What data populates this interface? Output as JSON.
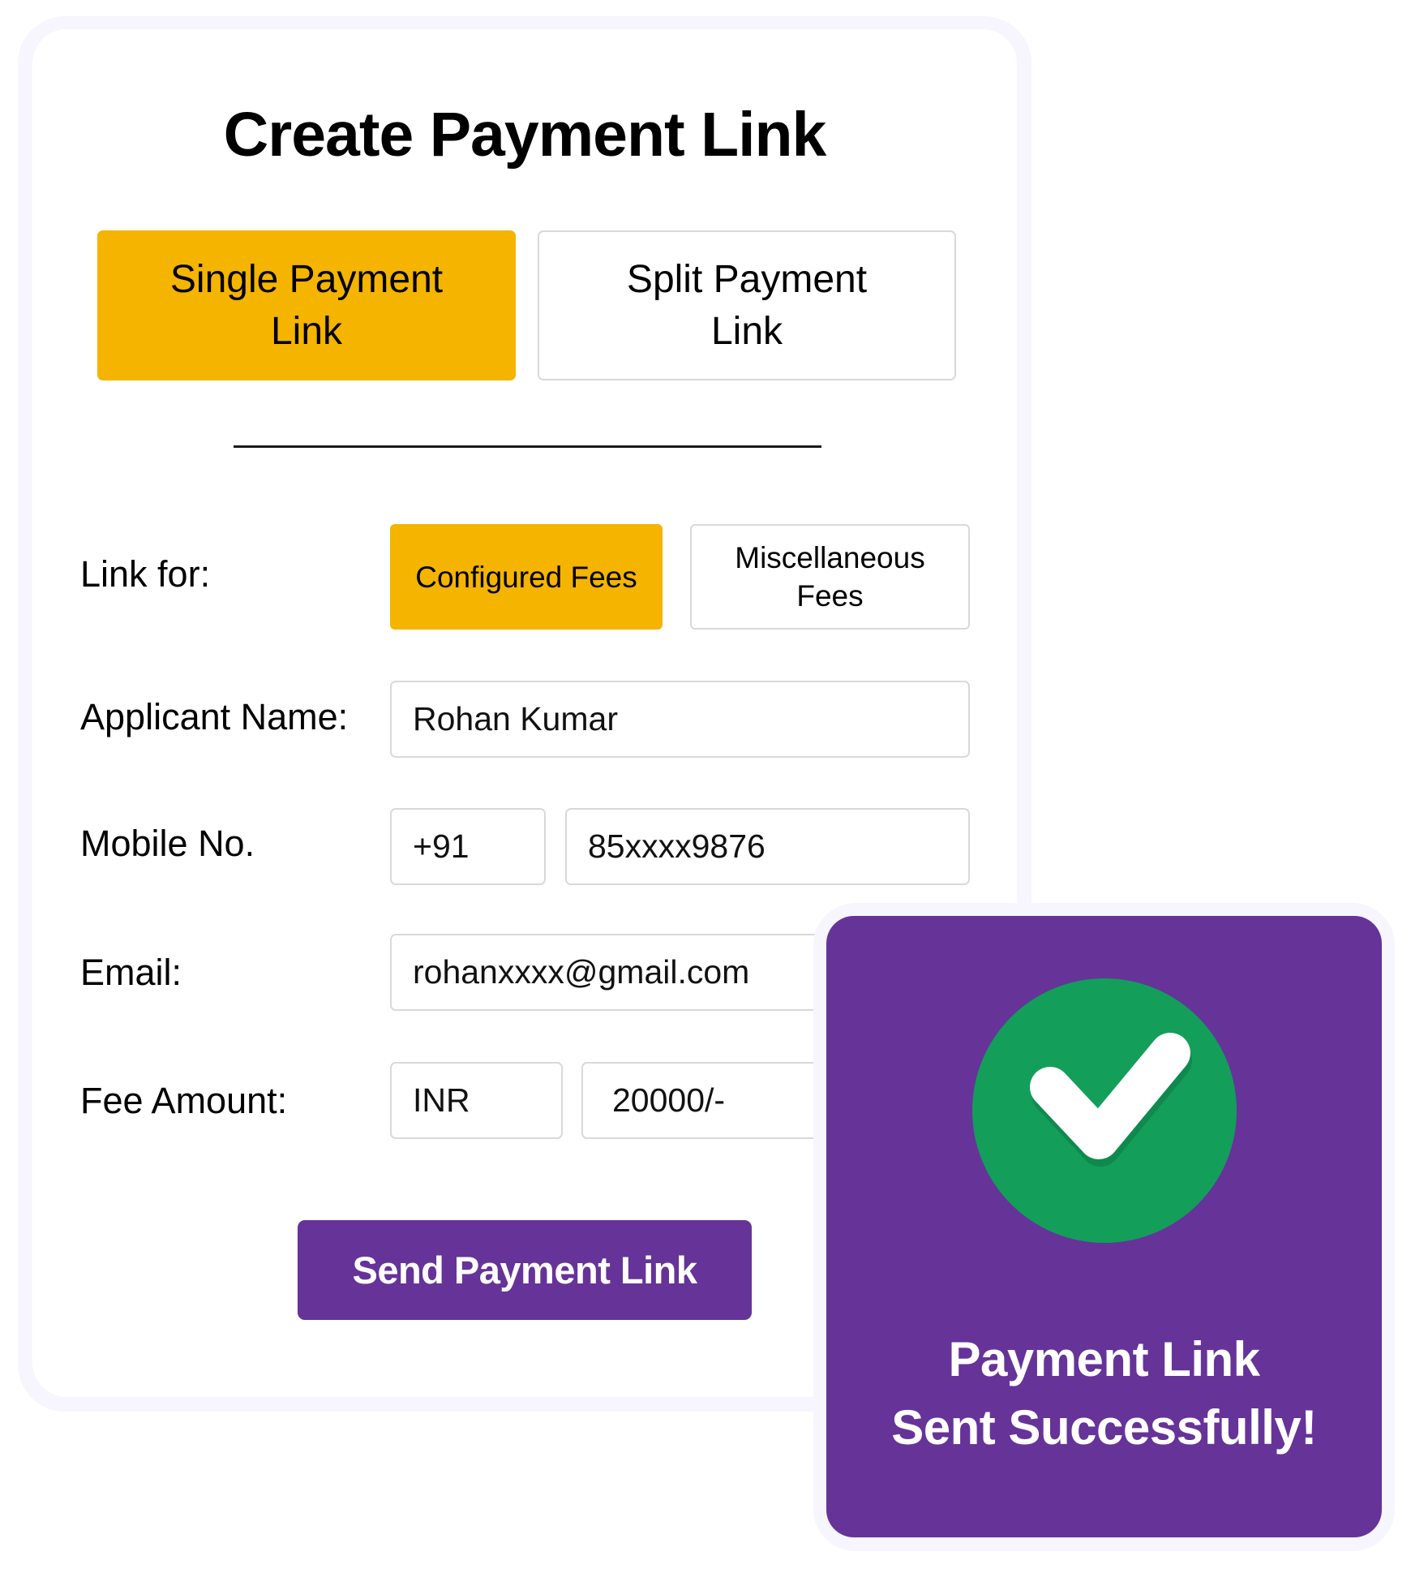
{
  "form": {
    "title": "Create Payment Link",
    "link_types": [
      {
        "label": "Single Payment Link",
        "selected": true
      },
      {
        "label": "Split Payment Link",
        "selected": false
      }
    ],
    "link_for": {
      "label": "Link for:",
      "options": [
        {
          "label": "Configured Fees",
          "selected": true
        },
        {
          "label": "Miscellaneous Fees",
          "selected": false
        }
      ]
    },
    "applicant_name": {
      "label": "Applicant Name:",
      "value": "Rohan Kumar"
    },
    "mobile": {
      "label": "Mobile No.",
      "country_code": "+91",
      "value": "85xxxx9876"
    },
    "email": {
      "label": "Email:",
      "value": "rohanxxxx@gmail.com"
    },
    "fee_amount": {
      "label": "Fee Amount:",
      "currency": "INR",
      "value": "20000/-"
    },
    "submit_label": "Send Payment Link"
  },
  "toast": {
    "icon": "check-circle-icon",
    "message": "Payment Link Sent Successfully!"
  },
  "colors": {
    "accent_yellow": "#f4b400",
    "brand_purple": "#663399",
    "success_green": "#139e5a"
  }
}
